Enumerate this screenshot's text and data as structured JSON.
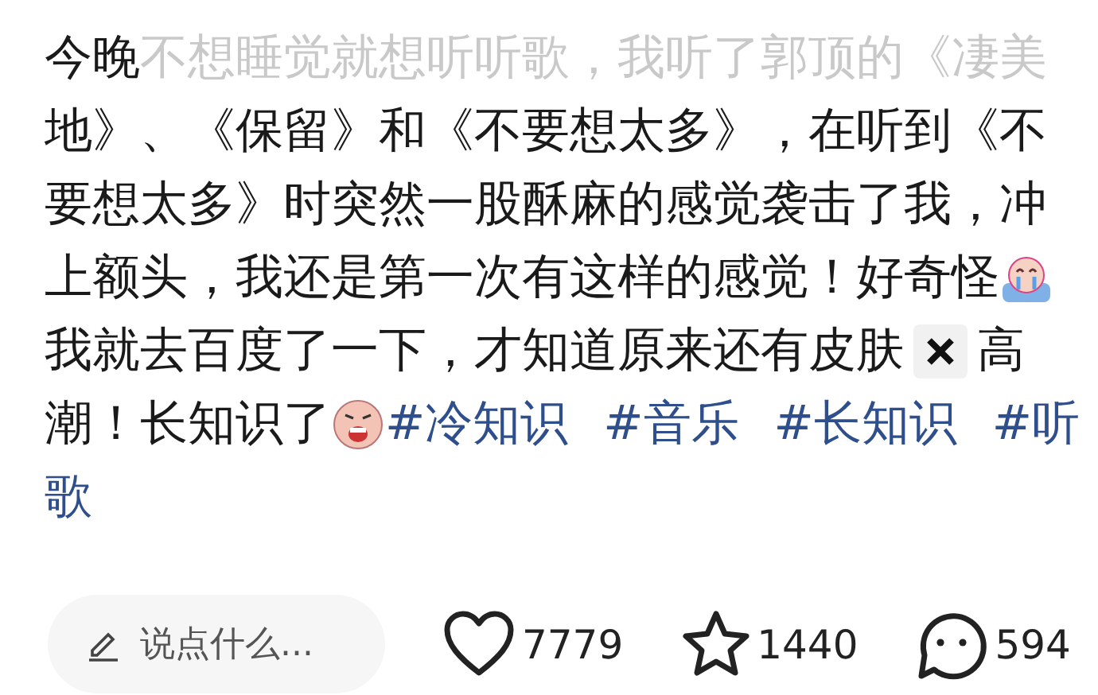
{
  "post": {
    "lines": [
      [
        {
          "kind": "text",
          "text": "今晚",
          "faded": false
        },
        {
          "kind": "text",
          "text": "不想睡觉就想听听歌，我听了郭顶的《凄美",
          "faded": true
        }
      ],
      [
        {
          "kind": "text",
          "text": "地》、《保留》和《不要想太多》，在听到《不",
          "faded": false
        }
      ],
      [
        {
          "kind": "text",
          "text": "要想太多》时突然一股酥麻的感觉袭击了我，冲",
          "faded": false
        }
      ],
      [
        {
          "kind": "text",
          "text": "上额头，我还是第一次有这样的感觉！好奇怪",
          "faded": false
        },
        {
          "kind": "crying"
        }
      ],
      [
        {
          "kind": "text",
          "text": "我就去百度了一下，才知道原来还有皮肤",
          "faded": false
        },
        {
          "kind": "cross"
        },
        {
          "kind": "text",
          "text": "高",
          "faded": false
        }
      ],
      [
        {
          "kind": "text",
          "text": "潮！长知识了",
          "faded": false
        },
        {
          "kind": "scared"
        },
        {
          "kind": "tag",
          "text": "#冷知识"
        },
        {
          "kind": "tag",
          "text": "#音乐"
        },
        {
          "kind": "tag",
          "text": "#长知识"
        },
        {
          "kind": "tag",
          "text": "#听"
        }
      ],
      [
        {
          "kind": "tag",
          "text": "歌"
        }
      ]
    ]
  },
  "comment_field": {
    "placeholder": "说点什么..."
  },
  "actions": [
    {
      "kind": "like",
      "count": "7779"
    },
    {
      "kind": "star",
      "count": "1440"
    },
    {
      "kind": "comment",
      "count": "594"
    }
  ]
}
